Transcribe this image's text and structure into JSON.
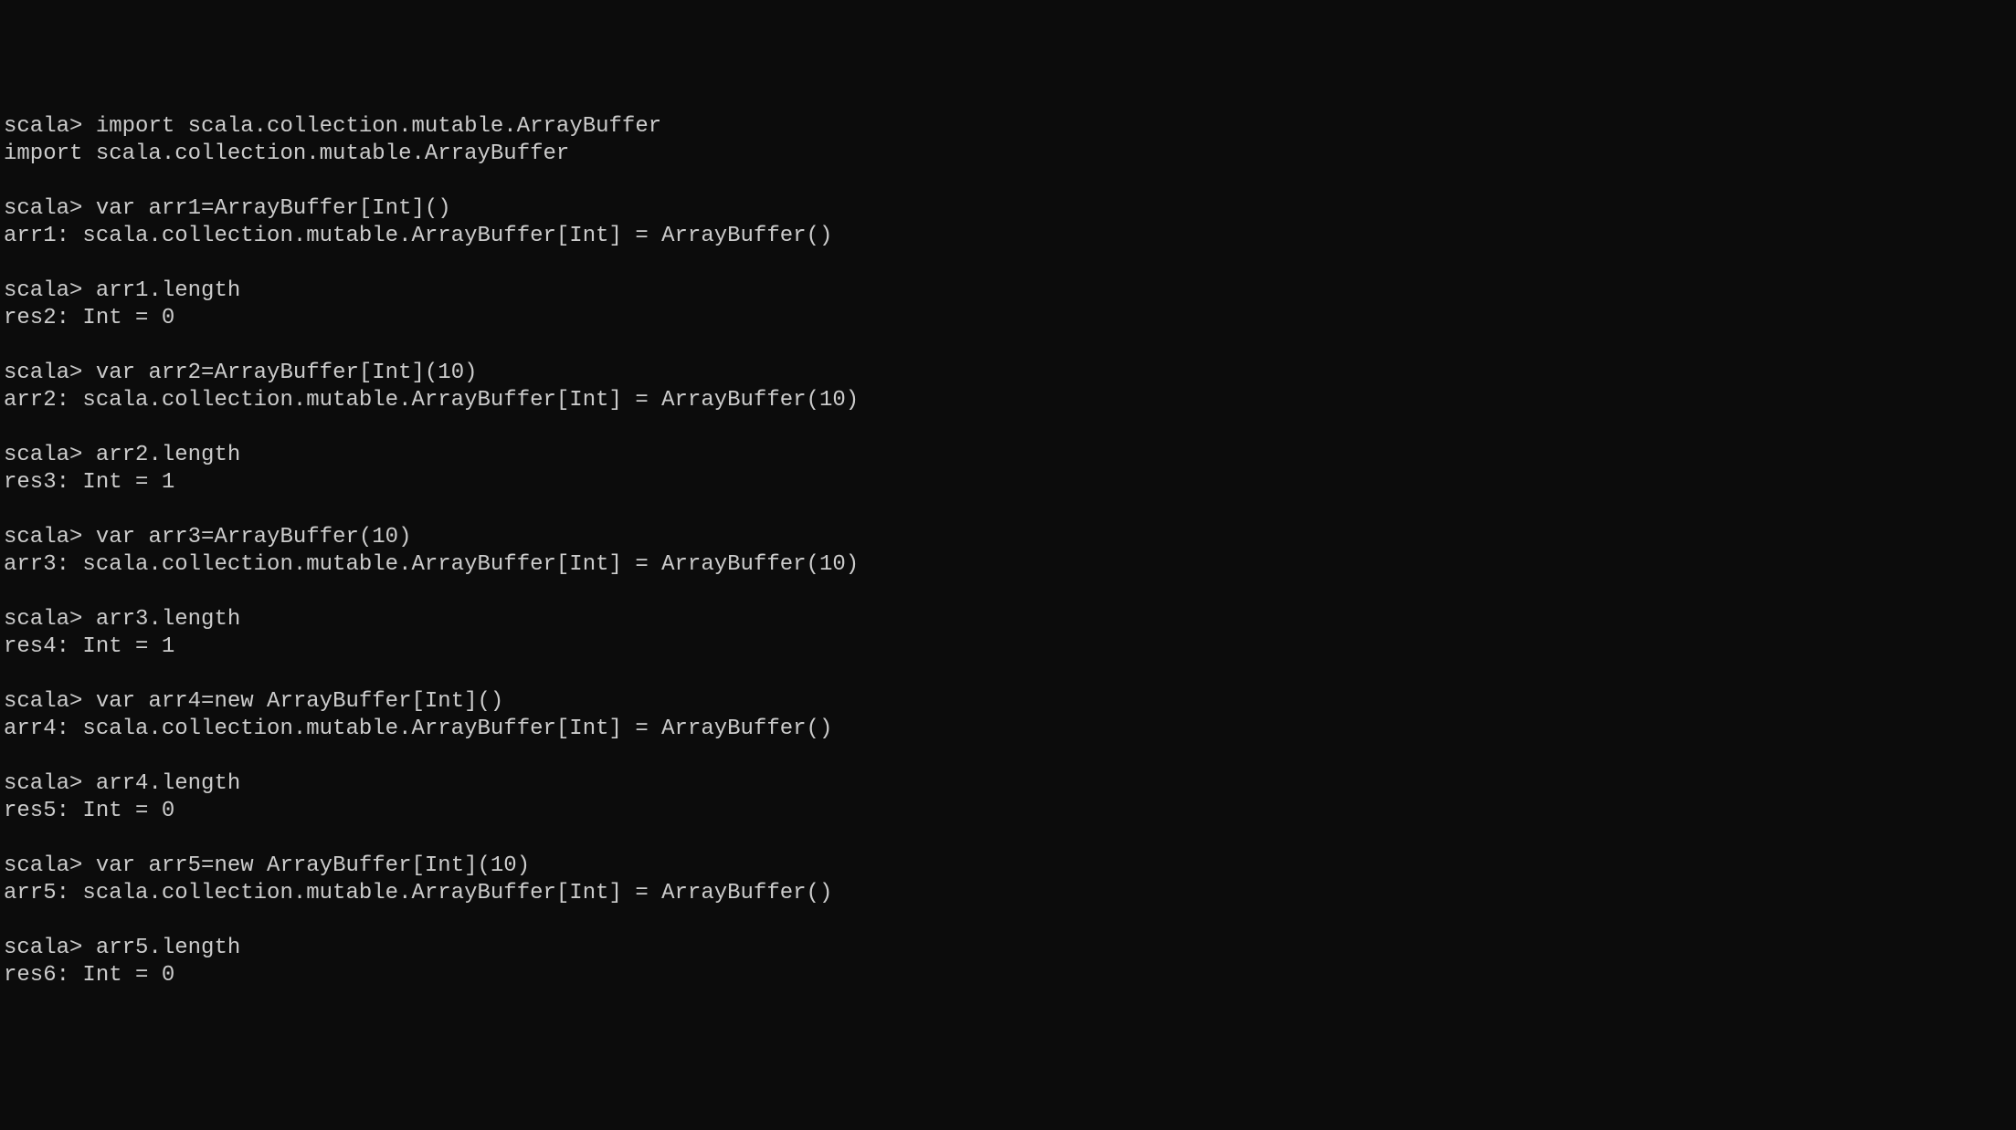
{
  "terminal": {
    "prompt": "scala>",
    "lines": [
      {
        "type": "input",
        "text": "import scala.collection.mutable.ArrayBuffer"
      },
      {
        "type": "output",
        "text": "import scala.collection.mutable.ArrayBuffer"
      },
      {
        "type": "blank",
        "text": ""
      },
      {
        "type": "input",
        "text": "var arr1=ArrayBuffer[Int]()"
      },
      {
        "type": "output",
        "text": "arr1: scala.collection.mutable.ArrayBuffer[Int] = ArrayBuffer()"
      },
      {
        "type": "blank",
        "text": ""
      },
      {
        "type": "input",
        "text": "arr1.length"
      },
      {
        "type": "output",
        "text": "res2: Int = 0"
      },
      {
        "type": "blank",
        "text": ""
      },
      {
        "type": "input",
        "text": "var arr2=ArrayBuffer[Int](10)"
      },
      {
        "type": "output",
        "text": "arr2: scala.collection.mutable.ArrayBuffer[Int] = ArrayBuffer(10)"
      },
      {
        "type": "blank",
        "text": ""
      },
      {
        "type": "input",
        "text": "arr2.length"
      },
      {
        "type": "output",
        "text": "res3: Int = 1"
      },
      {
        "type": "blank",
        "text": ""
      },
      {
        "type": "input",
        "text": "var arr3=ArrayBuffer(10)"
      },
      {
        "type": "output",
        "text": "arr3: scala.collection.mutable.ArrayBuffer[Int] = ArrayBuffer(10)"
      },
      {
        "type": "blank",
        "text": ""
      },
      {
        "type": "input",
        "text": "arr3.length"
      },
      {
        "type": "output",
        "text": "res4: Int = 1"
      },
      {
        "type": "blank",
        "text": ""
      },
      {
        "type": "input",
        "text": "var arr4=new ArrayBuffer[Int]()"
      },
      {
        "type": "output",
        "text": "arr4: scala.collection.mutable.ArrayBuffer[Int] = ArrayBuffer()"
      },
      {
        "type": "blank",
        "text": ""
      },
      {
        "type": "input",
        "text": "arr4.length"
      },
      {
        "type": "output",
        "text": "res5: Int = 0"
      },
      {
        "type": "blank",
        "text": ""
      },
      {
        "type": "input",
        "text": "var arr5=new ArrayBuffer[Int](10)"
      },
      {
        "type": "output",
        "text": "arr5: scala.collection.mutable.ArrayBuffer[Int] = ArrayBuffer()"
      },
      {
        "type": "blank",
        "text": ""
      },
      {
        "type": "input",
        "text": "arr5.length"
      },
      {
        "type": "output",
        "text": "res6: Int = 0"
      }
    ]
  }
}
